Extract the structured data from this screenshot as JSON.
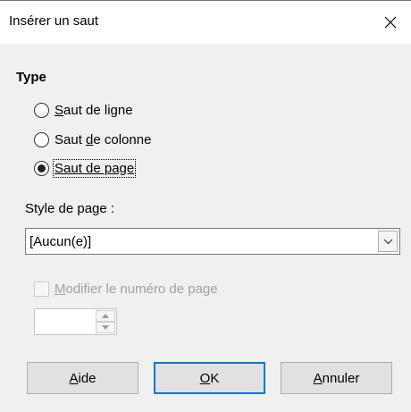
{
  "window": {
    "title": "Insérer un saut",
    "close_icon": "close-icon"
  },
  "type_section": {
    "label": "Type",
    "options": [
      {
        "prefix": "",
        "accel": "S",
        "rest": "aut de ligne",
        "checked": false
      },
      {
        "prefix": "Saut ",
        "accel": "d",
        "rest": "e colonne",
        "checked": false
      },
      {
        "prefix": "",
        "accel": "",
        "rest": "Saut de page",
        "checked": true
      }
    ]
  },
  "page_style": {
    "label": "Style de page :",
    "value": "[Aucun(e)]"
  },
  "change_page_number": {
    "accel": "M",
    "rest": "odifier le numéro de page",
    "checked": false,
    "enabled": false,
    "value": ""
  },
  "buttons": {
    "help": {
      "accel": "A",
      "rest": "ide"
    },
    "ok": {
      "accel": "O",
      "rest": "K"
    },
    "cancel": {
      "accel": "A",
      "rest": "nnuler"
    }
  },
  "colors": {
    "dialog_bg": "#f0f0f0",
    "default_button_border": "#0078d7",
    "disabled_text": "#a0a0a0"
  }
}
